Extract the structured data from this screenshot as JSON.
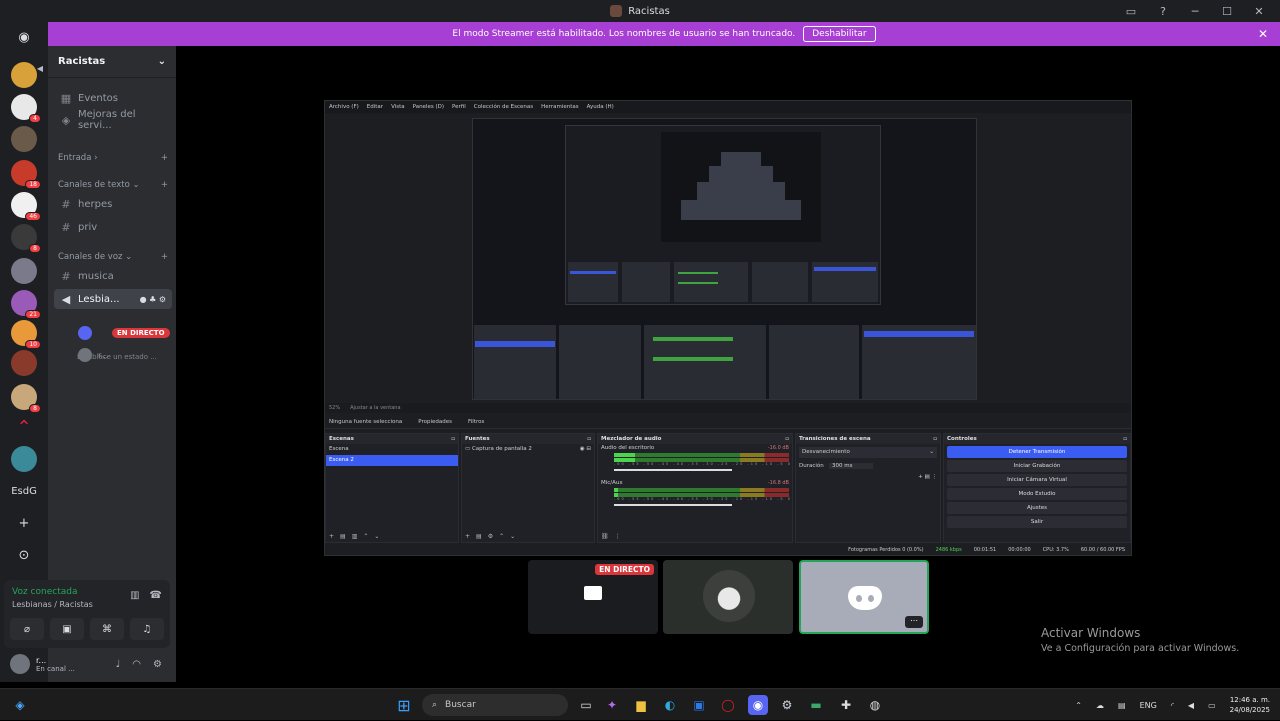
{
  "window": {
    "title": "Racistas"
  },
  "banner": {
    "text": "El modo Streamer está habilitado. Los nombres de usuario se han truncado.",
    "button": "Deshabilitar"
  },
  "guilds": {
    "badges": [
      "4",
      "18",
      "46",
      "8",
      "21",
      "10",
      "8"
    ],
    "label": "EsdG"
  },
  "sidebar": {
    "server_name": "Racistas",
    "items": [
      {
        "label": "Eventos"
      },
      {
        "label": "Mejoras del servi..."
      }
    ],
    "categories": {
      "entrada": "Entrada",
      "text": "Canales de texto",
      "voice": "Canales de voz"
    },
    "text_channels": [
      "herpes",
      "priv"
    ],
    "voice_channels": [
      "musica",
      "Lesbia..."
    ],
    "voice_status": "Establece un estado ...",
    "voice_users": [
      {
        "name": "",
        "live": "EN DIRECTO"
      },
      {
        "name": "r..."
      }
    ]
  },
  "voice_panel": {
    "status": "Voz conectada",
    "location": "Lesbianas / Racistas"
  },
  "user_panel": {
    "name": "r...",
    "status": "En canal ..."
  },
  "obs": {
    "menu": [
      "Archivo (F)",
      "Editar",
      "Vista",
      "Paneles (D)",
      "Perfil",
      "Colección de Escenas",
      "Herramientas",
      "Ayuda (H)"
    ],
    "status_left": [
      "52%",
      "Ajustar a la ventana"
    ],
    "tabs": [
      "Ninguna fuente selecciona",
      "Propiedades",
      "Filtros"
    ],
    "docks": {
      "scenes": {
        "title": "Escenas",
        "items": [
          "Escena",
          "Escena 2"
        ]
      },
      "sources": {
        "title": "Fuentes",
        "items": [
          "Captura de pantalla 2"
        ]
      },
      "mixer": {
        "title": "Mezclador de audio",
        "channels": [
          {
            "name": "Audio del escritorio",
            "db": "-16.0 dB",
            "level": 0.12
          },
          {
            "name": "Mic/Aux",
            "db": "-16.8 dB",
            "level": 0.02
          }
        ],
        "scale": "-60 -55 -50 -45 -40 -35 -30 -25 -20 -15 -10 -5 0"
      },
      "transitions": {
        "title": "Transiciones de escena",
        "type": "Desvanecimiento",
        "duration_label": "Duración",
        "duration": "300 ms"
      },
      "controls": {
        "title": "Controles",
        "buttons": [
          "Detener Transmisión",
          "Iniciar Grabación",
          "Iniciar Cámara Virtual",
          "Modo Estudio",
          "Ajustes",
          "Salir"
        ]
      }
    },
    "bottom": {
      "frames": "Fotogramas Perdidos 0 (0.0%)",
      "kbps": "2486 kbps",
      "time1": "00:01:51",
      "time2": "00:00:00",
      "cpu": "CPU: 3.7%",
      "fps": "60.00 / 60.00 FPS"
    }
  },
  "tiles": {
    "live": "EN DIRECTO"
  },
  "watermark": {
    "line1": "Activar Windows",
    "line2": "Ve a Configuración para activar Windows."
  },
  "taskbar": {
    "search_placeholder": "Buscar",
    "lang": "ENG",
    "time": "12:46 a. m.",
    "date": "24/08/2025"
  },
  "colors": {
    "banner": "#a73fd4",
    "live": "#da373c",
    "connected": "#23a55a",
    "obs_blue": "#3b5cf0"
  }
}
